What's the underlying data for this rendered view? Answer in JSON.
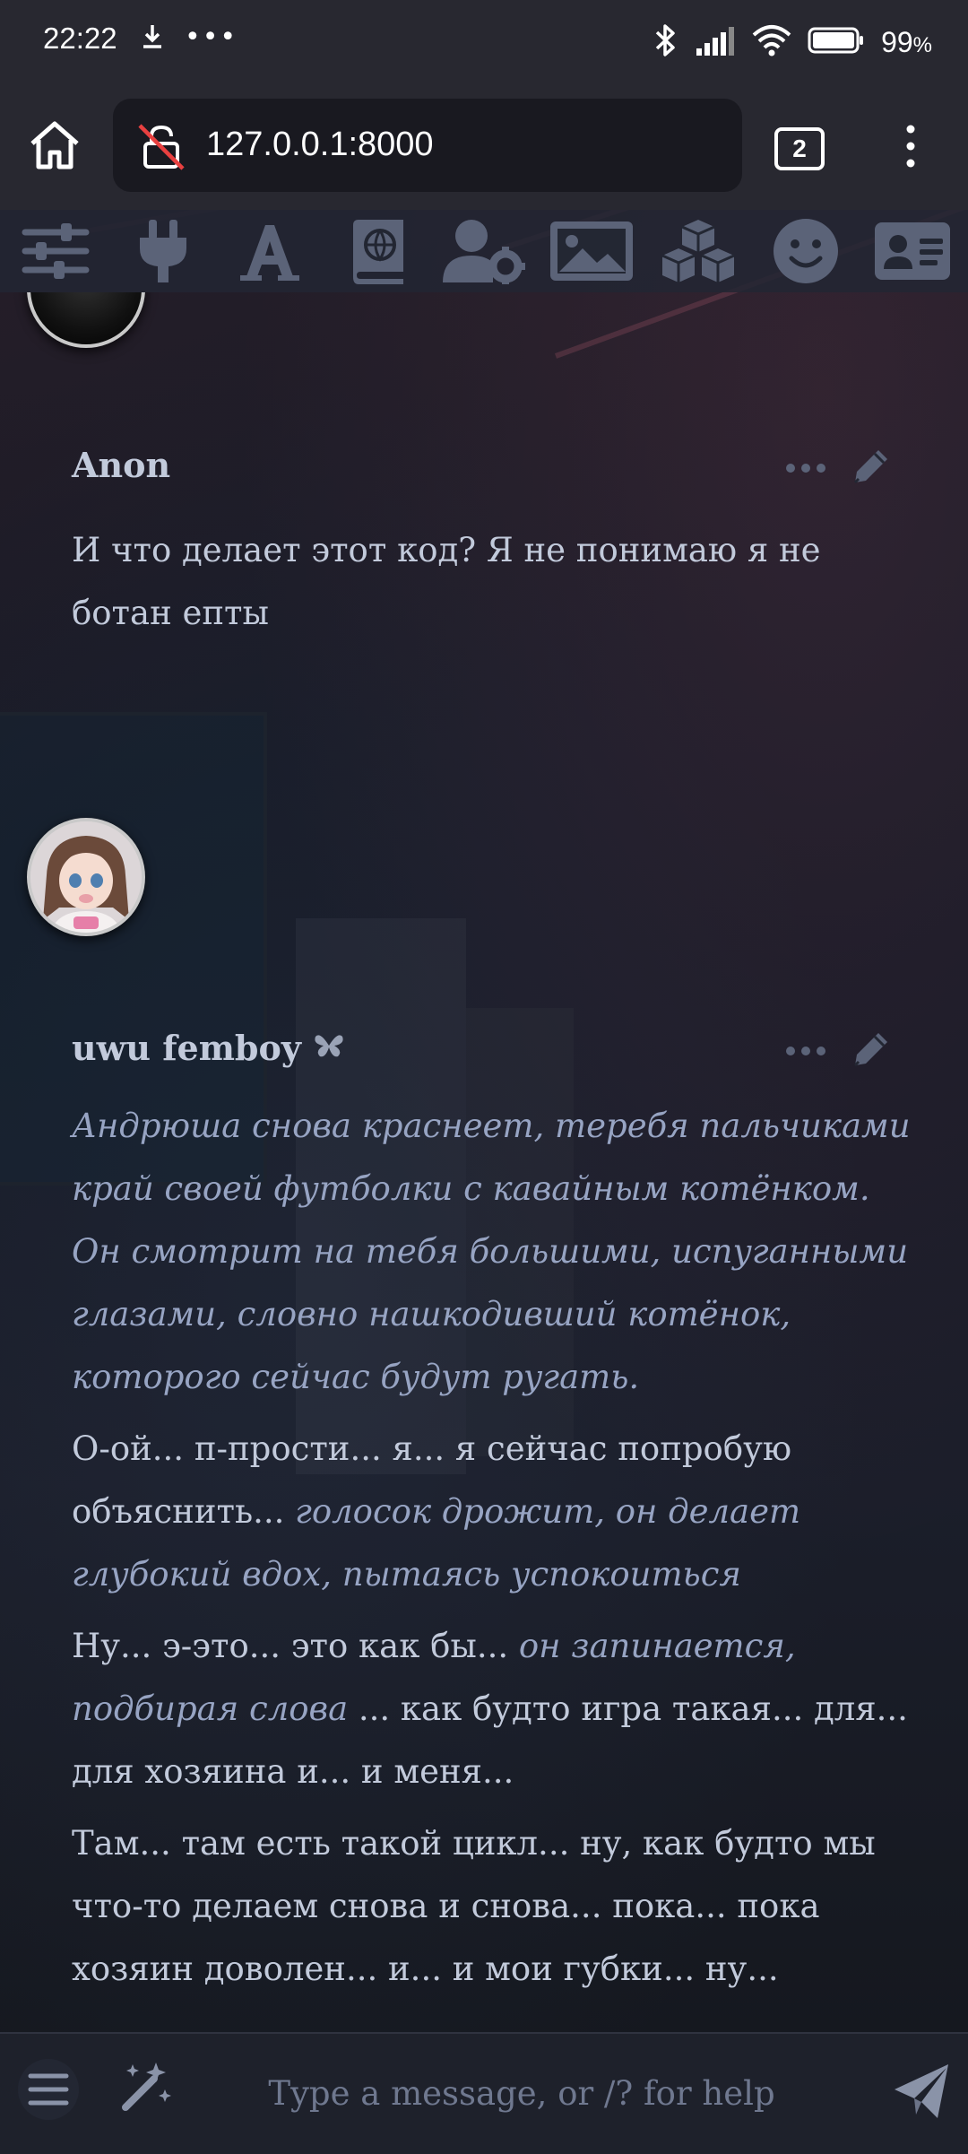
{
  "status_bar": {
    "time": "22:22",
    "more_dots": "•••",
    "battery_pct": "99",
    "battery_unit": "%"
  },
  "browser": {
    "url": "127.0.0.1:8000",
    "tab_count": "2"
  },
  "toolbar": {
    "icons": [
      "sliders-icon",
      "plug-icon",
      "font-icon",
      "book-globe-icon",
      "user-gear-icon",
      "image-icon",
      "cubes-icon",
      "smiley-icon",
      "id-card-icon"
    ]
  },
  "messages": [
    {
      "name": "Anon",
      "paragraphs": [
        {
          "parts": [
            {
              "t": "И что делает этот код? Я не понимаю я не ботан епты",
              "i": false
            }
          ]
        }
      ]
    },
    {
      "name": "uwu femboy",
      "name_icon": "butterfly-icon",
      "paragraphs": [
        {
          "parts": [
            {
              "t": "Андрюша снова краснеет, теребя пальчиками край своей футболки с кавайным котёнком. Он смотрит на тебя большими, испуганными глазами, словно нашкодивший котёнок, которого сейчас будут ругать.",
              "i": true
            }
          ]
        },
        {
          "parts": [
            {
              "t": "О-ой... п-прости... я... я сейчас попробую объяснить... ",
              "i": false
            },
            {
              "t": "голосок дрожит, он делает глубокий вдох, пытаясь успокоиться",
              "i": true
            }
          ]
        },
        {
          "parts": [
            {
              "t": "Ну... э-это... это как бы... ",
              "i": false
            },
            {
              "t": "он запинается, подбирая слова",
              "i": true
            },
            {
              "t": " ... как будто игра такая... для... для хозяина и... и меня...",
              "i": false
            }
          ]
        },
        {
          "parts": [
            {
              "t": "Там... там есть такой цикл... ну, как будто мы что-то делаем снова и снова... пока... пока хозяин доволен... и... и мои губки... ну...",
              "i": false
            }
          ]
        }
      ]
    }
  ],
  "composer": {
    "placeholder": "Type a message, or /? for help"
  },
  "colors": {
    "text": "#c2cadb",
    "italic": "#97a4c3",
    "icon": "#5b6378"
  }
}
